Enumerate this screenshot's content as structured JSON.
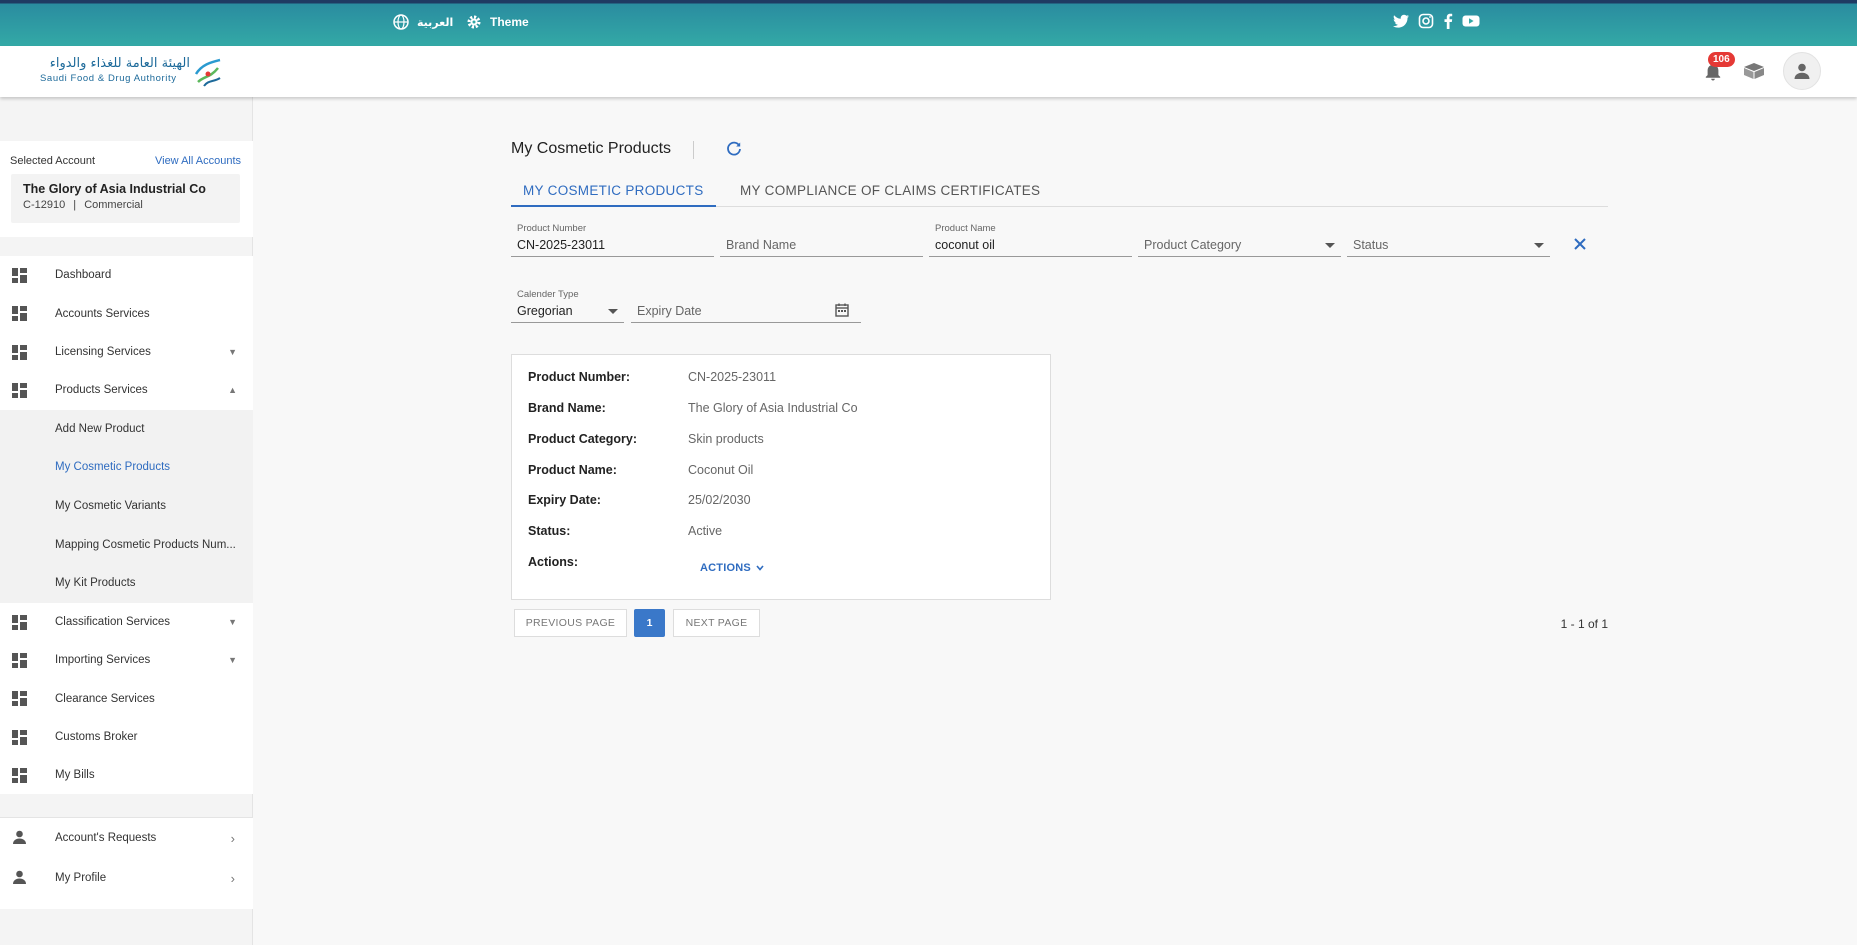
{
  "topbar": {
    "language_label": "العربية",
    "theme_label": "Theme",
    "social_icons": [
      "twitter-icon",
      "instagram-icon",
      "facebook-icon",
      "youtube-icon"
    ],
    "background_colors": [
      "#1f3a63",
      "#33a9a6"
    ]
  },
  "header": {
    "logo_arabic": "الهيئة العامة للغذاء والدواء",
    "logo_english": "Saudi Food & Drug Authority",
    "notification_count": "106"
  },
  "sidebar": {
    "selected_account_label": "Selected Account",
    "view_all_label": "View All Accounts",
    "account_name": "The Glory of Asia Industrial Co",
    "account_id": "C-12910",
    "account_type": "Commercial",
    "items": [
      {
        "label": "Dashboard",
        "icon": "dashboard-icon",
        "expand": ""
      },
      {
        "label": "Accounts Services",
        "icon": "dashboard-icon",
        "expand": ""
      },
      {
        "label": "Licensing Services",
        "icon": "dashboard-icon",
        "expand": "▼"
      },
      {
        "label": "Products Services",
        "icon": "dashboard-icon",
        "expand": "▲"
      }
    ],
    "sub_items": [
      {
        "label": "Add New Product"
      },
      {
        "label": "My Cosmetic Products"
      },
      {
        "label": "My Cosmetic Variants"
      },
      {
        "label": "Mapping Cosmetic Products Num..."
      },
      {
        "label": "My Kit Products"
      }
    ],
    "items_after": [
      {
        "label": "Classification Services",
        "expand": "▼"
      },
      {
        "label": "Importing Services",
        "expand": "▼"
      },
      {
        "label": "Clearance Services",
        "expand": ""
      },
      {
        "label": "Customs Broker",
        "expand": ""
      },
      {
        "label": "My Bills",
        "expand": ""
      }
    ],
    "bottom_items": [
      {
        "label": "Account's Requests"
      },
      {
        "label": "My Profile"
      }
    ],
    "accent_color": "#2f6cc0"
  },
  "main": {
    "title": "My Cosmetic Products",
    "tabs": [
      {
        "label": "MY COSMETIC PRODUCTS"
      },
      {
        "label": "MY COMPLIANCE OF CLAIMS CERTIFICATES"
      }
    ],
    "filters": {
      "product_number_label": "Product Number",
      "product_number_value": "CN-2025-23011",
      "brand_name_placeholder": "Brand Name",
      "product_name_label": "Product Name",
      "product_name_value": "coconut oil",
      "product_category_placeholder": "Product Category",
      "status_placeholder": "Status",
      "calender_type_label": "Calender Type",
      "calender_type_value": "Gregorian",
      "expiry_date_placeholder": "Expiry Date"
    },
    "product": {
      "rows": [
        {
          "key": "Product Number:",
          "value": "CN-2025-23011"
        },
        {
          "key": "Brand Name:",
          "value": "The Glory of Asia Industrial Co"
        },
        {
          "key": "Product Category:",
          "value": "Skin products"
        },
        {
          "key": "Product Name:",
          "value": "Coconut Oil"
        },
        {
          "key": "Expiry Date:",
          "value": "25/02/2030"
        },
        {
          "key": "Status:",
          "value": "Active"
        },
        {
          "key": "Actions:",
          "value": ""
        }
      ],
      "actions_label": "ACTIONS"
    },
    "pagination": {
      "previous_label": "PREVIOUS PAGE",
      "current_page": "1",
      "next_label": "NEXT PAGE",
      "count_text": "1 - 1 of 1"
    }
  }
}
